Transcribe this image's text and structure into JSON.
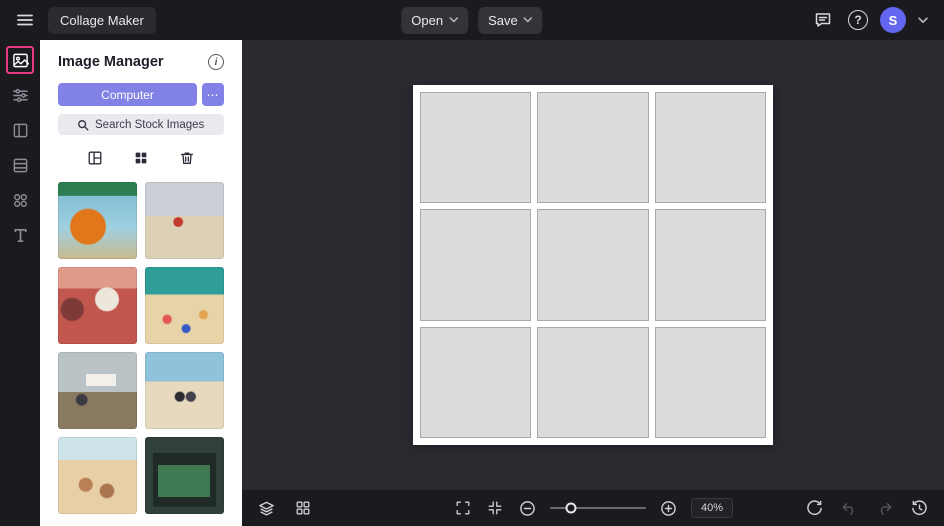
{
  "colors": {
    "accent_purple": "#8181e6",
    "accent_pink": "#ea3a81",
    "avatar_bg": "#6366ef",
    "topbar_bg": "#1a1a1f",
    "canvas_bg": "#2a2a31"
  },
  "topbar": {
    "app_button_label": "Collage Maker",
    "open_label": "Open",
    "save_label": "Save",
    "avatar_initial": "S"
  },
  "rail": {
    "items": [
      "images",
      "adjust",
      "frames",
      "templates",
      "elements",
      "text"
    ],
    "active_item": "images"
  },
  "image_manager": {
    "title": "Image Manager",
    "source_button_label": "Computer",
    "more_button_label": "⋯",
    "search_placeholder": "Search Stock Images",
    "thumbnails": [
      {
        "name": "photo-thumbnail-1",
        "variant": "t1",
        "alt": "person in orange robe under green canopy by the sea"
      },
      {
        "name": "photo-thumbnail-2",
        "variant": "t2",
        "alt": "person in red on an empty beach"
      },
      {
        "name": "photo-thumbnail-3",
        "variant": "t3",
        "alt": "pink-toned pool scene with beach ball"
      },
      {
        "name": "photo-thumbnail-4",
        "variant": "t4",
        "alt": "beach shoreline with umbrellas and towels"
      },
      {
        "name": "photo-thumbnail-5",
        "variant": "t5",
        "alt": "boardwalk pier with sign"
      },
      {
        "name": "photo-thumbnail-6",
        "variant": "t6",
        "alt": "two people walking near the beach"
      },
      {
        "name": "photo-thumbnail-7",
        "variant": "t7",
        "alt": "people bathing in shallow water"
      },
      {
        "name": "photo-thumbnail-8",
        "variant": "t8",
        "alt": "green lifeguard hut"
      }
    ]
  },
  "canvas": {
    "collage": {
      "rows": 3,
      "cols": 3
    }
  },
  "bottombar": {
    "zoom_value": "40%"
  }
}
